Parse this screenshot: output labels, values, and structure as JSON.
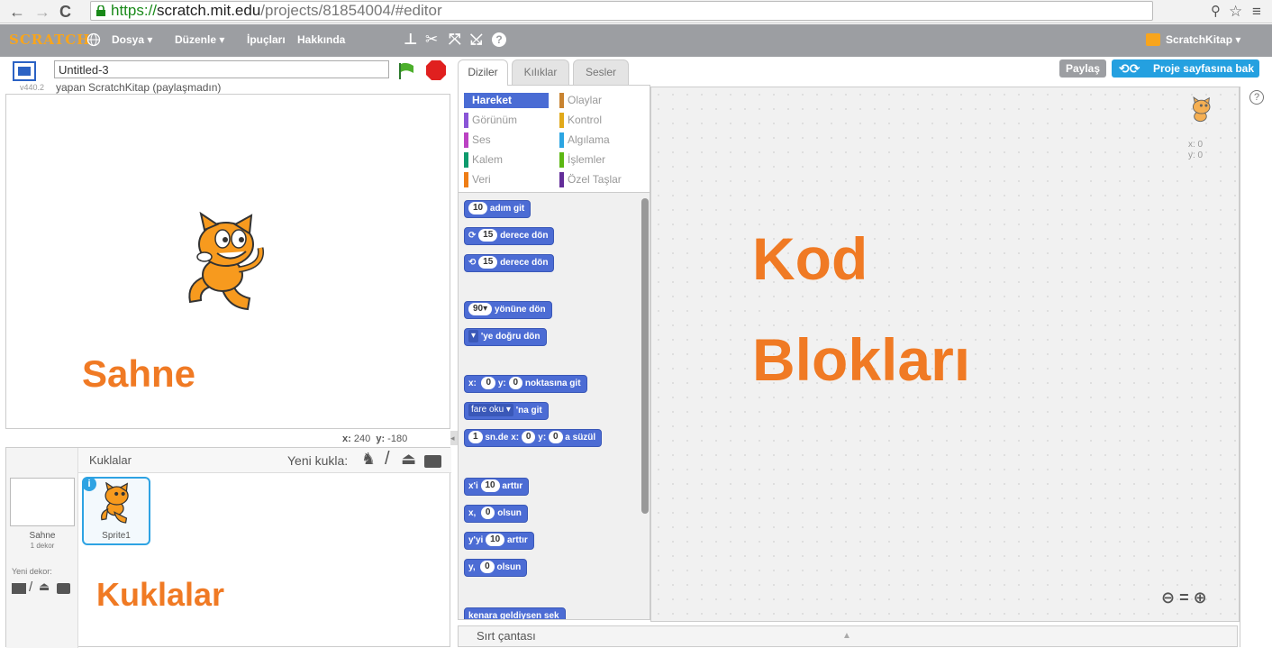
{
  "browser": {
    "url_scheme": "https://",
    "url_host": "scratch.mit.edu",
    "url_path": "/projects/81854004/#editor"
  },
  "menubar": {
    "logo": "SCRATCH",
    "items": [
      "Dosya ▾",
      "Düzenle ▾",
      "İpuçları",
      "Hakkında"
    ],
    "account": "ScratchKitap ▾",
    "tools": [
      "stamp-icon",
      "scissors-icon",
      "grow-icon",
      "shrink-icon",
      "help-icon"
    ]
  },
  "stage": {
    "project_title": "Untitled-3",
    "version": "v440.2",
    "author_line": "yapan ScratchKitap (paylaşmadın)",
    "coords_x_label": "x:",
    "coords_x": "240",
    "coords_y_label": "y:",
    "coords_y": "-180"
  },
  "actions": {
    "share": "Paylaş",
    "project_page": "Proje sayfasına bak"
  },
  "tabs": [
    "Diziler",
    "Kılıklar",
    "Sesler"
  ],
  "categories": [
    {
      "label": "Hareket",
      "color": "#4a6cd4",
      "selected": true
    },
    {
      "label": "Olaylar",
      "color": "#c88330"
    },
    {
      "label": "Görünüm",
      "color": "#8a55d7"
    },
    {
      "label": "Kontrol",
      "color": "#e1a91a"
    },
    {
      "label": "Ses",
      "color": "#bb42c3"
    },
    {
      "label": "Algılama",
      "color": "#2ca5e2"
    },
    {
      "label": "Kalem",
      "color": "#0e9a6c"
    },
    {
      "label": "İşlemler",
      "color": "#5cb712"
    },
    {
      "label": "Veri",
      "color": "#ee7d16"
    },
    {
      "label": "Özel Taşlar",
      "color": "#632d99"
    }
  ],
  "blocks": {
    "move": {
      "value": "10",
      "text": "adım git"
    },
    "turn_right": {
      "value": "15",
      "text": "derece dön"
    },
    "turn_left": {
      "value": "15",
      "text": "derece dön"
    },
    "point_dir": {
      "value": "90▾",
      "text": "yönüne dön"
    },
    "point_towards": {
      "value": "▾",
      "text": "'ye doğru dön"
    },
    "goto_xy": {
      "x_label": "x:",
      "x": "0",
      "y_label": "y:",
      "y": "0",
      "text": "noktasına git"
    },
    "goto": {
      "value": "fare oku ▾",
      "text": "'na git"
    },
    "glide": {
      "secs": "1",
      "text1": "sn.de x:",
      "x": "0",
      "text2": "y:",
      "y": "0",
      "text3": "a süzül"
    },
    "change_x": {
      "label": "x'i",
      "value": "10",
      "text": "arttır"
    },
    "set_x": {
      "label": "x,",
      "value": "0",
      "text": "olsun"
    },
    "change_y": {
      "label": "y'yi",
      "value": "10",
      "text": "arttır"
    },
    "set_y": {
      "label": "y,",
      "value": "0",
      "text": "olsun"
    },
    "bounce": {
      "text": "kenara geldiysen sek"
    }
  },
  "sprites_panel": {
    "header": "Kuklalar",
    "new_sprite": "Yeni kukla:",
    "stage_label": "Sahne",
    "stage_backdrops": "1 dekor",
    "new_backdrop": "Yeni dekor:",
    "sprite_name": "Sprite1",
    "info_badge": "i"
  },
  "script_area": {
    "sprite_x": "x: 0",
    "sprite_y": "y: 0"
  },
  "backpack": {
    "label": "Sırt çantası"
  },
  "annotations": {
    "stage": "Sahne",
    "sprites": "Kuklalar",
    "code_line1": "Kod",
    "code_line2": "Blokları"
  }
}
